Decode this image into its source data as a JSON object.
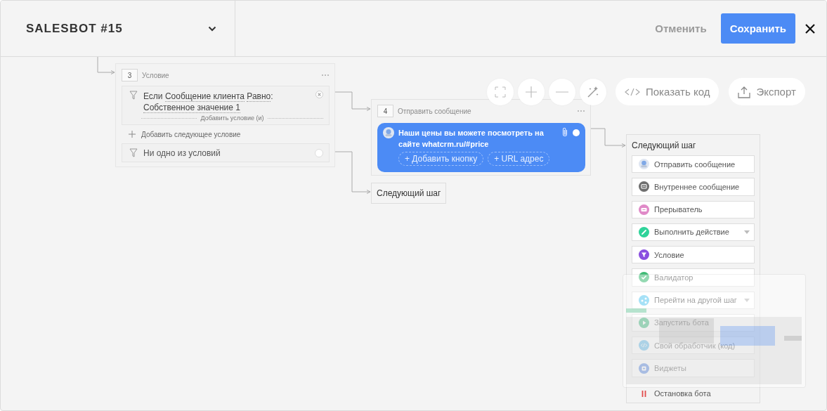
{
  "header": {
    "title": "SALESBOT #15",
    "cancel": "Отменить",
    "save": "Сохранить"
  },
  "toolbar": {
    "show_code": "Показать код",
    "export": "Экспорт"
  },
  "condition_node": {
    "number": "3",
    "title": "Условие",
    "condition": {
      "prefix": "Если",
      "field": "Сообщение клиента",
      "operator": "Равно",
      "suffix": ":",
      "value": "Собственное значение 1"
    },
    "add_condition": "Добавить условие (и)",
    "add_next": "Добавить следующее условие",
    "fallback": "Ни одно из условий"
  },
  "message_node": {
    "number": "4",
    "title": "Отправить сообщение",
    "text": "Наши цены вы можете посмотреть на сайте whatcrm.ru/#price",
    "buttons": [
      "+ Добавить кнопку",
      "+ URL адрес"
    ]
  },
  "next_step_stub": "Следующий шаг",
  "next_step_menu": {
    "title": "Следующий шаг",
    "items": [
      {
        "kind": "send",
        "label": "Отправить сообщение",
        "dropdown": false
      },
      {
        "kind": "internal",
        "label": "Внутреннее сообщение",
        "dropdown": false
      },
      {
        "kind": "interrupt",
        "label": "Прерыватель",
        "dropdown": false
      },
      {
        "kind": "action",
        "label": "Выполнить действие",
        "dropdown": true
      },
      {
        "kind": "condition",
        "label": "Условие",
        "dropdown": false
      },
      {
        "kind": "validator",
        "label": "Валидатор",
        "dropdown": false
      },
      {
        "kind": "goto",
        "label": "Перейти на другой шаг",
        "dropdown": true
      },
      {
        "kind": "start",
        "label": "Запустить бота",
        "dropdown": false
      },
      {
        "kind": "code",
        "label": "Свой обработчик (код)",
        "dropdown": false
      },
      {
        "kind": "widgets",
        "label": "Виджеты",
        "dropdown": false
      },
      {
        "kind": "stop",
        "label": "Остановка бота",
        "dropdown": false
      }
    ]
  }
}
